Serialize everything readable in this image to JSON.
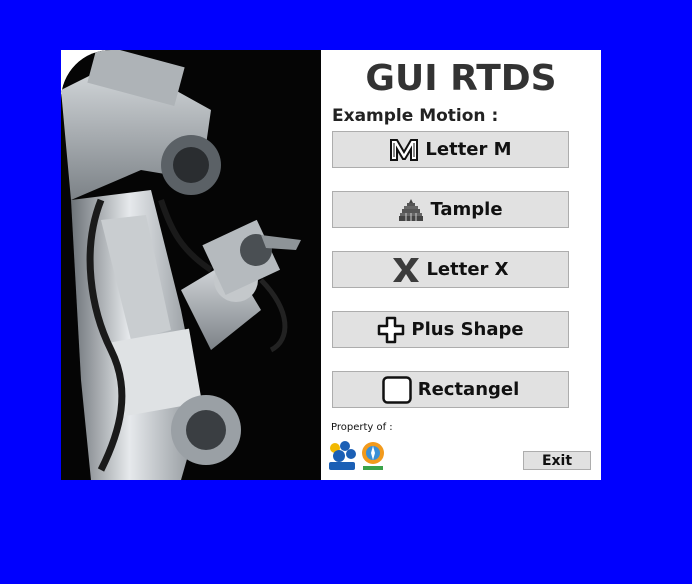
{
  "app": {
    "title": "GUI RTDS",
    "subtitle": "Example Motion :"
  },
  "buttons": [
    {
      "label": "Letter M",
      "icon": "letter-m-icon"
    },
    {
      "label": "Tample",
      "icon": "temple-icon"
    },
    {
      "label": "Letter X",
      "icon": "letter-x-icon"
    },
    {
      "label": "Plus Shape",
      "icon": "plus-icon"
    },
    {
      "label": "Rectangel",
      "icon": "square-icon"
    }
  ],
  "footer": {
    "property_label": "Property of :",
    "exit_label": "Exit"
  },
  "colors": {
    "background": "#0000ff",
    "panel": "#ffffff",
    "button": "#e1e1e1",
    "title": "#333333"
  }
}
